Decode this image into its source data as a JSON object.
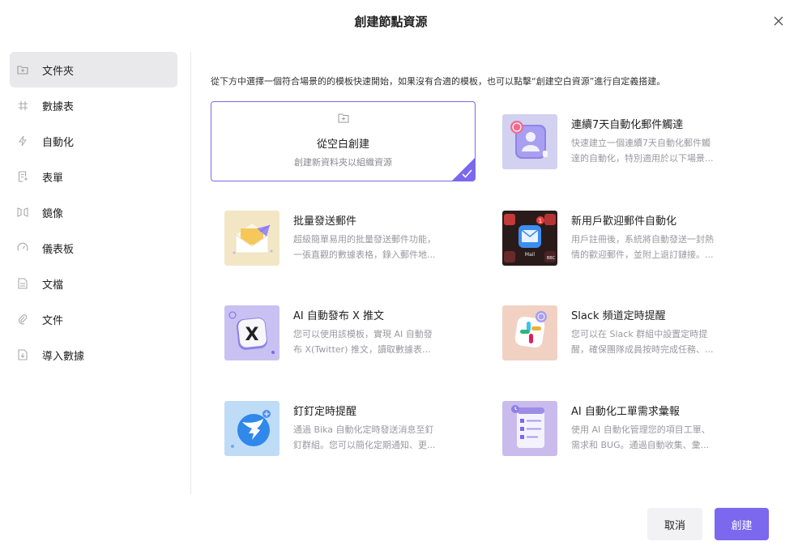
{
  "dialog": {
    "title": "創建節點資源"
  },
  "sidebar": {
    "items": [
      {
        "label": "文件夾",
        "icon": "folder-icon",
        "active": true
      },
      {
        "label": "數據表",
        "icon": "grid-icon"
      },
      {
        "label": "自動化",
        "icon": "bolt-icon"
      },
      {
        "label": "表單",
        "icon": "form-icon"
      },
      {
        "label": "鏡像",
        "icon": "mirror-icon"
      },
      {
        "label": "儀表板",
        "icon": "gauge-icon"
      },
      {
        "label": "文檔",
        "icon": "doc-icon"
      },
      {
        "label": "文件",
        "icon": "paperclip-icon"
      },
      {
        "label": "導入數據",
        "icon": "import-icon"
      }
    ]
  },
  "main": {
    "intro": "從下方中選擇一個符合場景的的模板快速開始，如果沒有合適的模板，也可以點擊“創建空白資源”進行自定義搭建。",
    "blank": {
      "title": "從空白創建",
      "subtitle": "創建新資料夾以組織資源"
    },
    "templates": [
      {
        "title": "連續7天自動化郵件觸達",
        "desc1": "快速建立一個連續7天自動化郵件觸",
        "desc2": "達的自動化，特別適用於以下場景..."
      },
      {
        "title": "批量發送郵件",
        "desc1": "超級簡單易用的批量發送郵件功能，",
        "desc2": "一張直觀的數據表格，錄入郵件地..."
      },
      {
        "title": "新用戶歡迎郵件自動化",
        "desc1": "用戶註冊後，系統將自動發送一封熱",
        "desc2": "情的歡迎郵件，並附上退訂鏈接。..."
      },
      {
        "title": "AI 自動發布 X 推文",
        "desc1": "您可以使用該模板，實現 AI 自動發",
        "desc2": "布 X(Twitter) 推文，讀取數據表..."
      },
      {
        "title": "Slack 頻道定時提醒",
        "desc1": "您可以在 Slack 群組中設置定時提",
        "desc2": "醒，確保團隊成員按時完成任務、..."
      },
      {
        "title": "釘釘定時提醒",
        "desc1": "通過 Bika 自動化定時發送消息至釘",
        "desc2": "釘群組。您可以簡化定期通知、更..."
      },
      {
        "title": "AI 自動化工單需求彙報",
        "desc1": "使用 AI 自動化管理您的項目工單、",
        "desc2": "需求和 BUG。通過自動收集、彙..."
      }
    ],
    "thumb_text": {
      "mail_app": "Mail",
      "bbc": "BBC",
      "x_logo": "X",
      "badge_num": "1"
    }
  },
  "footer": {
    "cancel": "取消",
    "create": "創建"
  },
  "colors": {
    "accent": "#7b68ee"
  }
}
